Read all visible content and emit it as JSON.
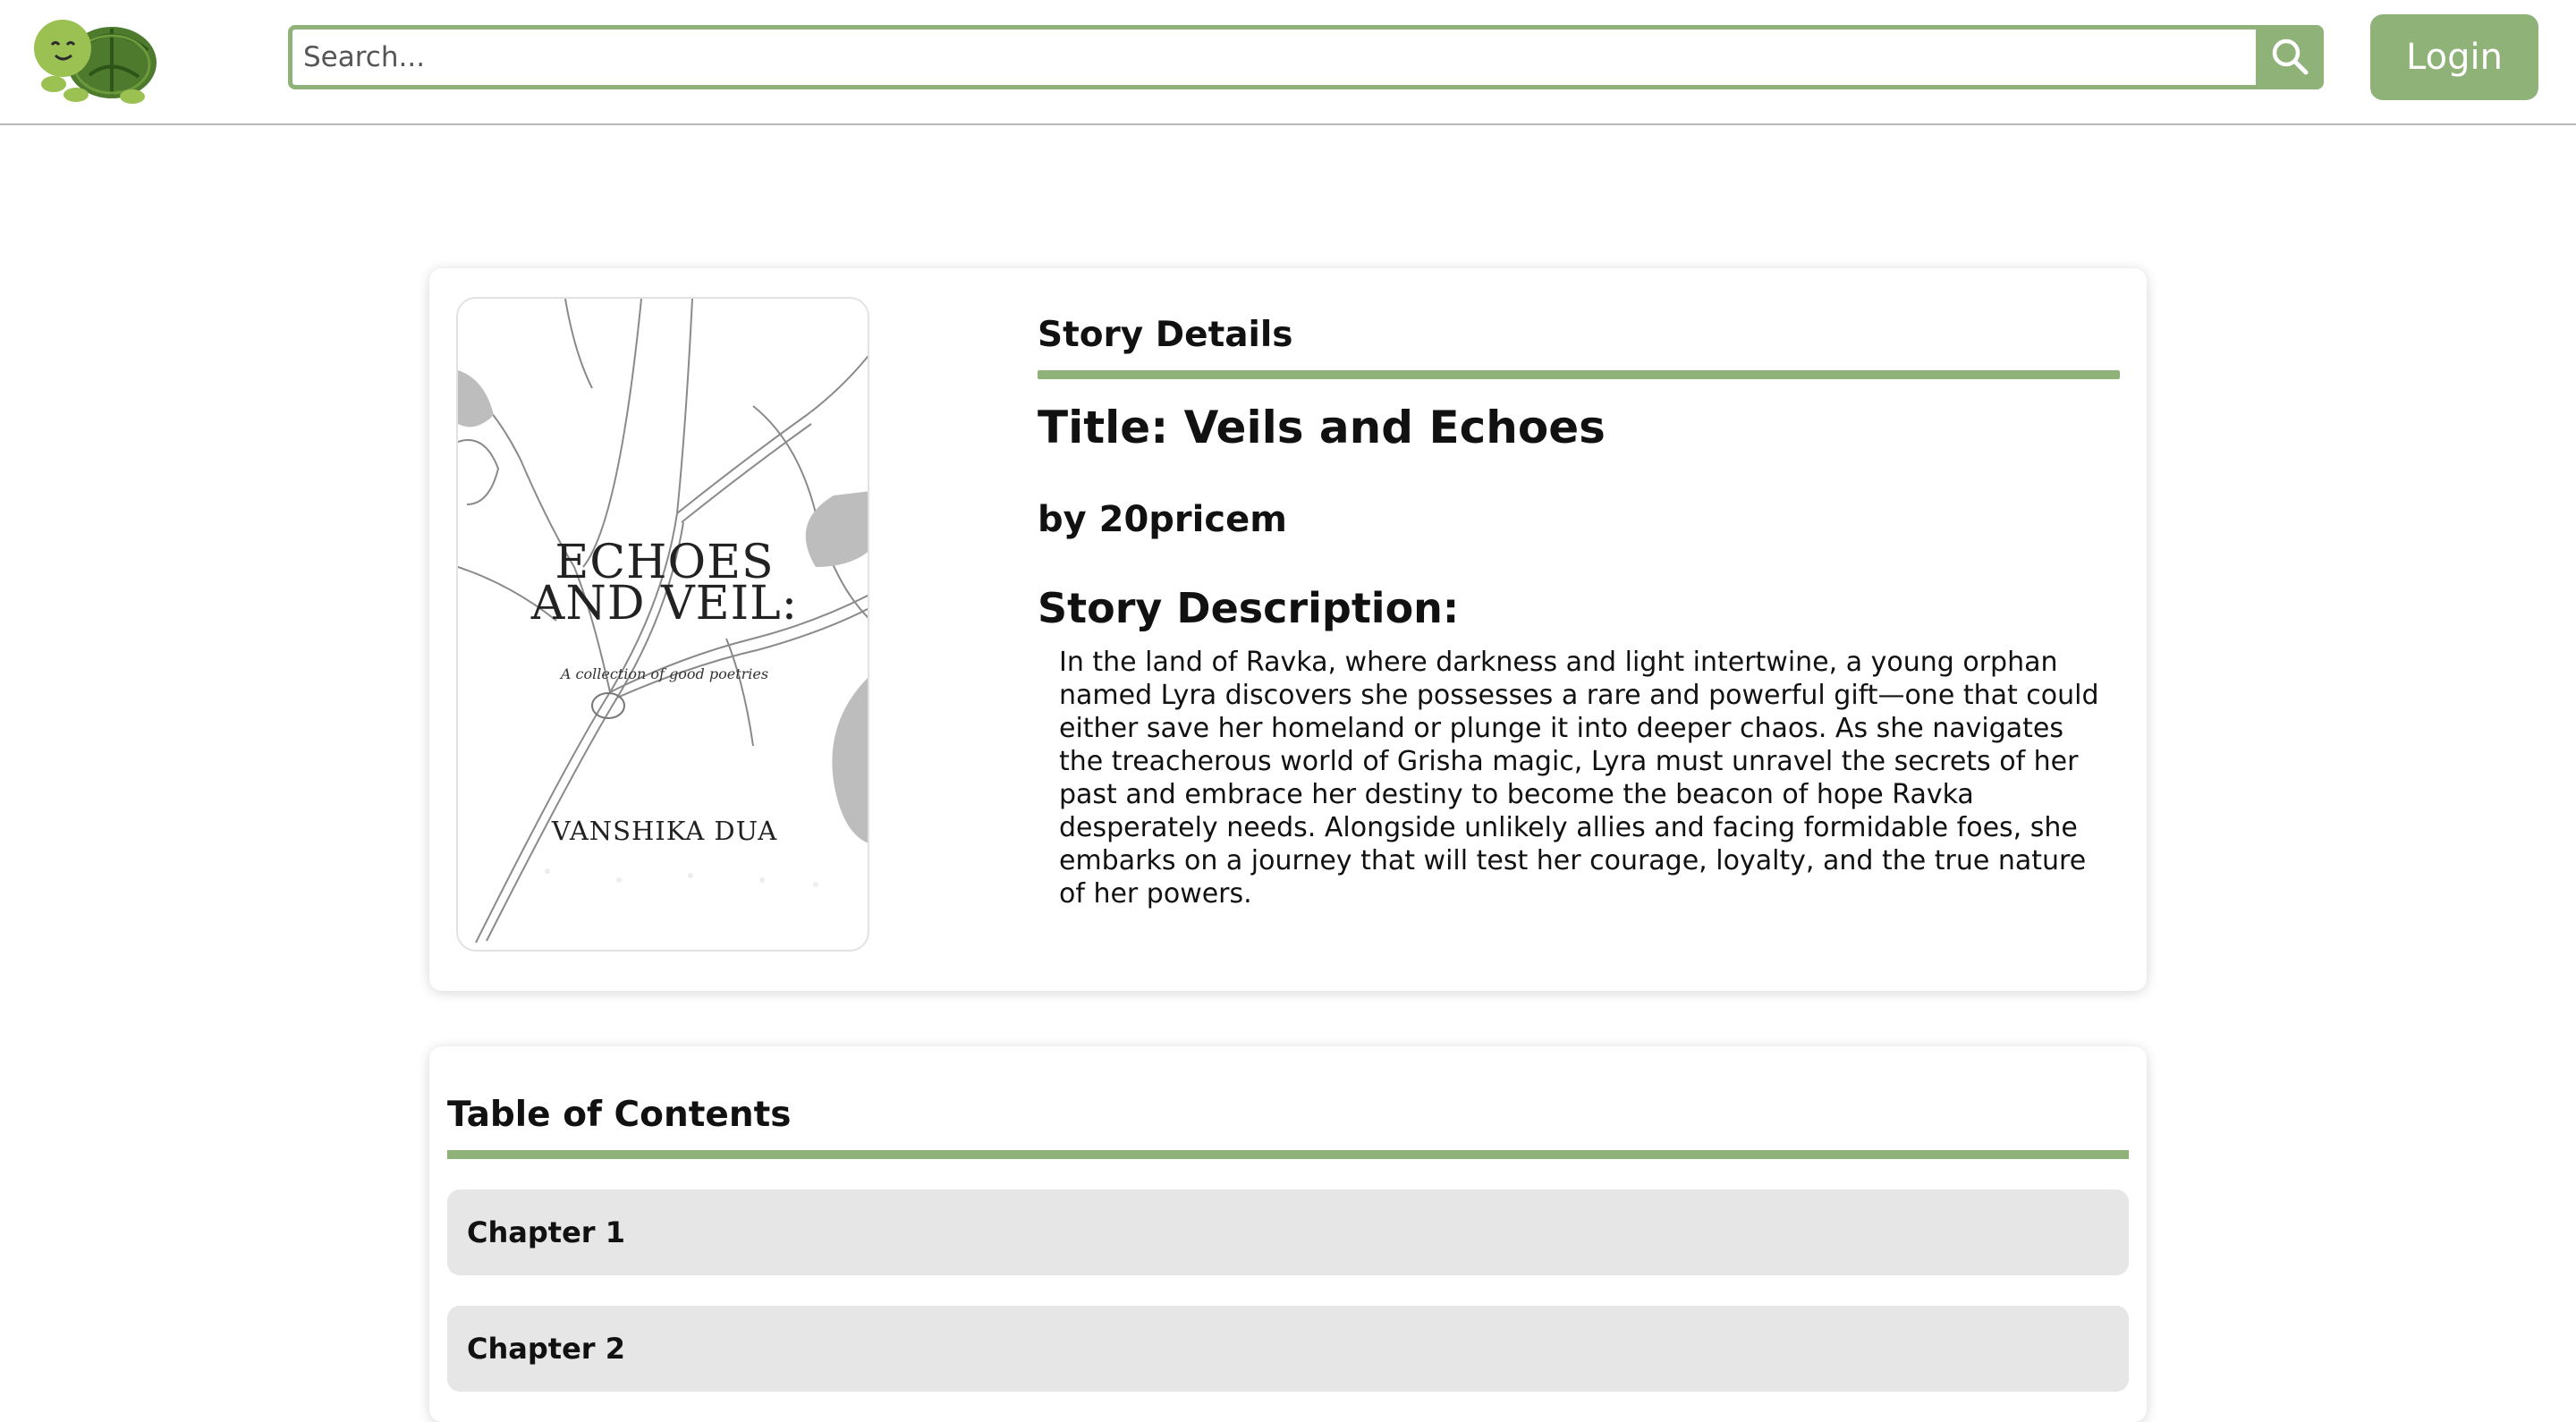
{
  "header": {
    "logo_icon": "turtle-icon",
    "search": {
      "placeholder": "Search...",
      "value": "",
      "icon": "search-icon"
    },
    "login_label": "Login",
    "accent_color": "#8fb278"
  },
  "story": {
    "section_heading": "Story Details",
    "title": "Title: Veils and Echoes",
    "author": "by 20pricem",
    "description_heading": "Story Description:",
    "description": "In the land of Ravka, where darkness and light intertwine, a young orphan named Lyra discovers she possesses a rare and powerful gift—one that could either save her homeland or plunge it into deeper chaos. As she navigates the treacherous world of Grisha magic, Lyra must unravel the secrets of her past and embrace her destiny to become the beacon of hope Ravka desperately needs. Alongside unlikely allies and facing formidable foes, she embarks on a journey that will test her courage, loyalty, and the true nature of her powers.",
    "cover": {
      "title_line1": "ECHOES",
      "title_line2": "AND VEIL:",
      "subtitle": "A collection of good poetries",
      "author": "VANSHIKA DUA"
    }
  },
  "toc": {
    "heading": "Table of Contents",
    "chapters": [
      {
        "label": "Chapter 1"
      },
      {
        "label": "Chapter 2"
      }
    ]
  }
}
